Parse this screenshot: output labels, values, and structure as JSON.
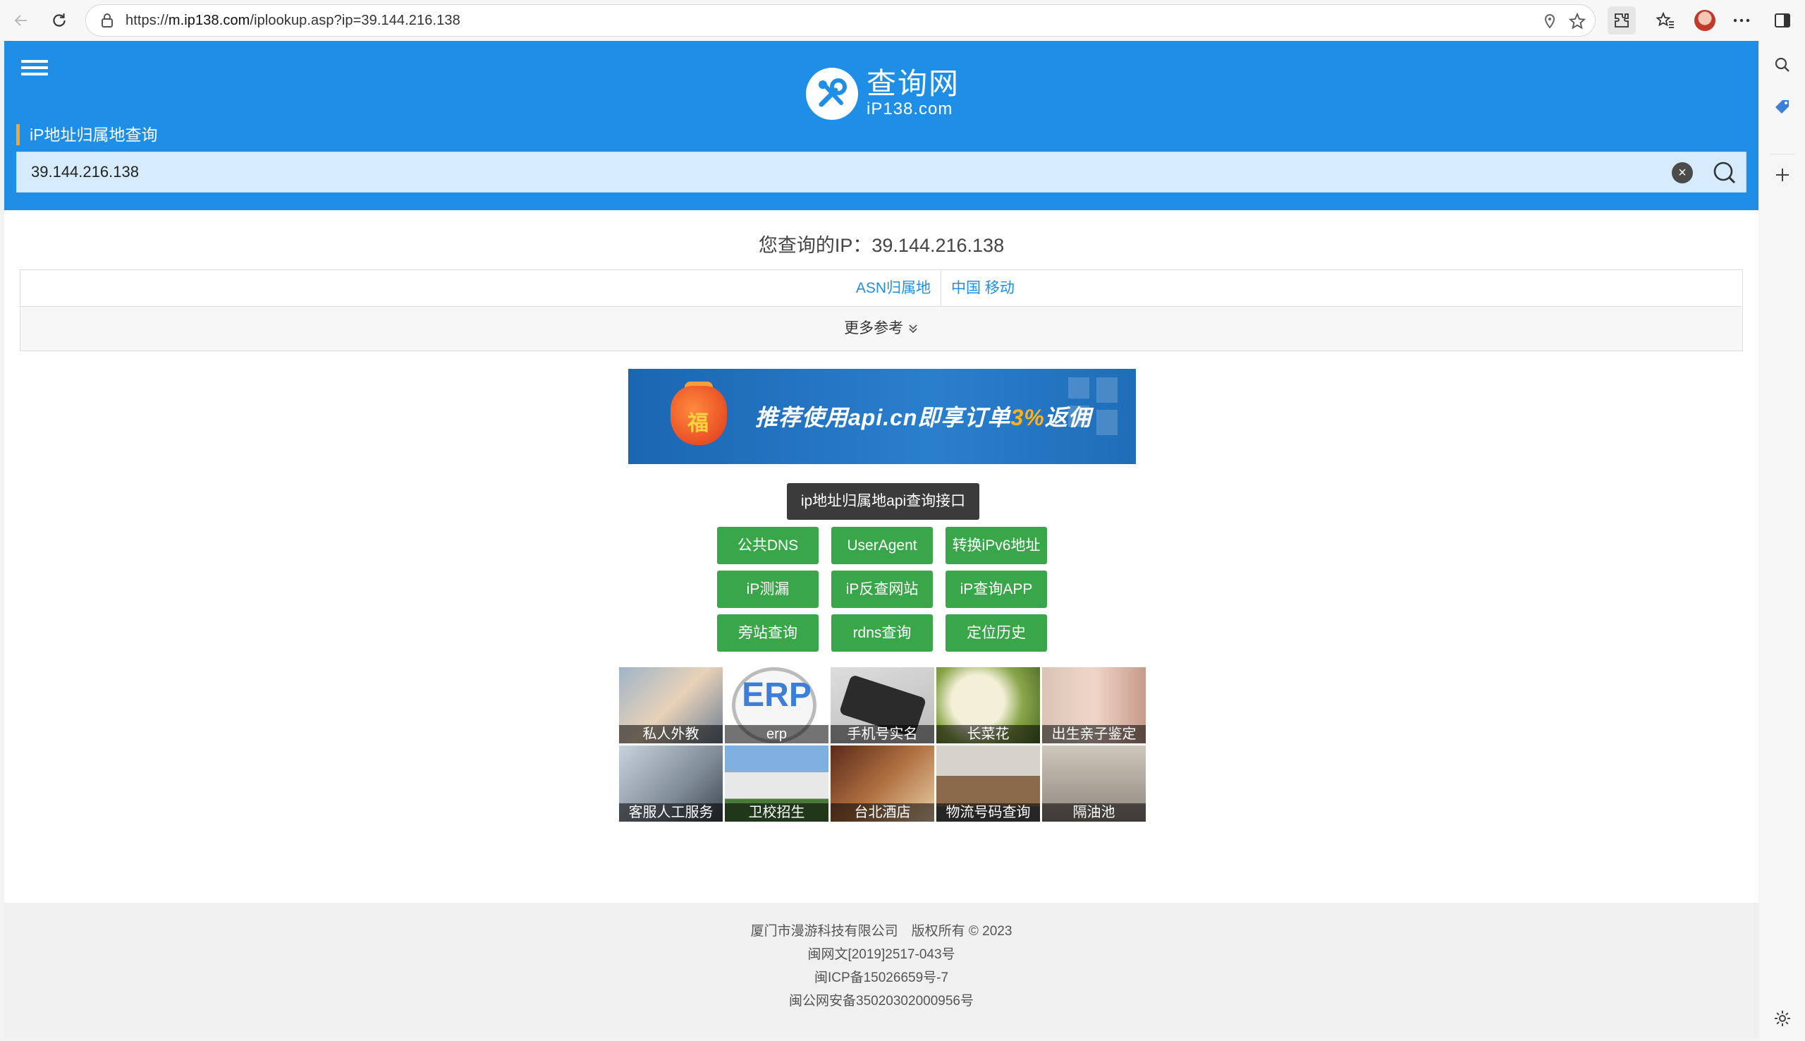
{
  "browser": {
    "url_prefix": "https://",
    "url_host": "m.ip138.com",
    "url_path": "/iplookup.asp?ip=39.144.216.138"
  },
  "header": {
    "logo_cn": "查询网",
    "logo_en": "iP138.com",
    "search_label": "iP地址归属地查询",
    "search_value": "39.144.216.138"
  },
  "result": {
    "title": "您查询的IP：39.144.216.138",
    "asn_key": "ASN归属地",
    "asn_value": "中国 移动",
    "more": "更多参考"
  },
  "banner": {
    "fu": "福",
    "text_a": "推荐使用api.cn即享订单",
    "text_b": "3%",
    "text_c": "返佣"
  },
  "api_button": "ip地址归属地api查询接口",
  "tools": [
    "公共DNS",
    "UserAgent",
    "转换iPv6地址",
    "iP测漏",
    "iP反查网站",
    "iP查询APP",
    "旁站查询",
    "rdns查询",
    "定位历史"
  ],
  "thumbs": [
    "私人外教",
    "erp",
    "手机号实名",
    "长菜花",
    "出生亲子鉴定",
    "客服人工服务",
    "卫校招生",
    "台北酒店",
    "物流号码查询",
    "隔油池"
  ],
  "footer": {
    "line1": "厦门市漫游科技有限公司　版权所有 © 2023",
    "line2": "闽网文[2019]2517-043号",
    "line3": "闽ICP备15026659号-7",
    "line4": "闽公网安备35020302000956号"
  },
  "colors": {
    "header_blue": "#1e8ee6",
    "button_green": "#3aa64a",
    "accent_orange": "#f5a623"
  }
}
